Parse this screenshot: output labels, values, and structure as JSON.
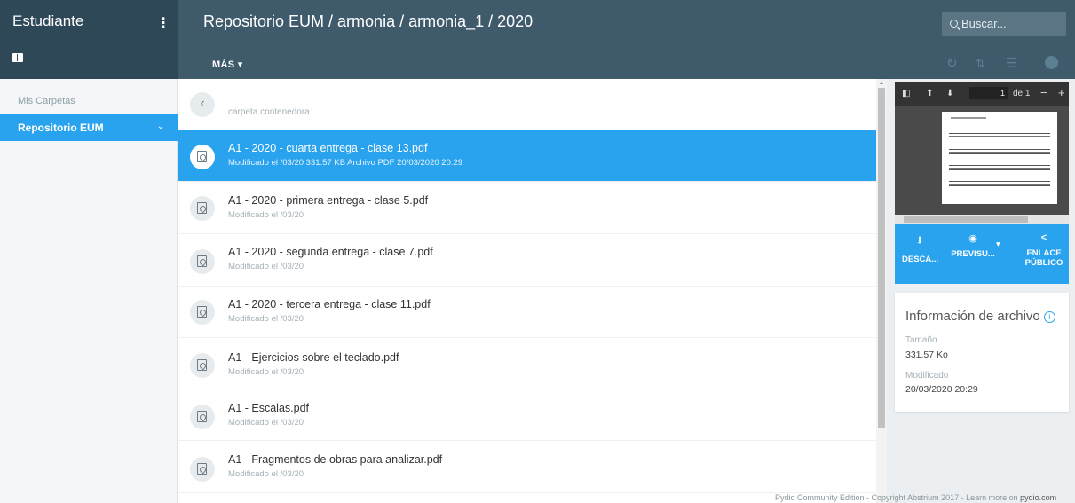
{
  "app": {
    "brand": "Estudiante"
  },
  "header": {
    "breadcrumb": "Repositorio EUM / armonia / armonia_1 / 2020",
    "search_placeholder": "Buscar...",
    "more_label": "MÁS"
  },
  "sidebar": {
    "section_label": "Mis Carpetas",
    "items": [
      {
        "label": "Repositorio EUM"
      }
    ]
  },
  "list": {
    "parent": {
      "name": "..",
      "meta": "carpeta contenedora"
    },
    "files": [
      {
        "name": "A1 - 2020 - cuarta entrega - clase 13.pdf",
        "meta": "Modificado el /03/20  331.57 KB  Archivo PDF  20/03/2020 20:29",
        "selected": true
      },
      {
        "name": "A1 - 2020 - primera entrega - clase 5.pdf",
        "meta": "Modificado el /03/20"
      },
      {
        "name": "A1 - 2020 - segunda entrega - clase 7.pdf",
        "meta": "Modificado el /03/20"
      },
      {
        "name": "A1 - 2020 - tercera entrega - clase 11.pdf",
        "meta": "Modificado el /03/20"
      },
      {
        "name": "A1 - Ejercicios sobre el teclado.pdf",
        "meta": "Modificado el /03/20"
      },
      {
        "name": "A1 - Escalas.pdf",
        "meta": "Modificado el /03/20"
      },
      {
        "name": "A1 - Fragmentos de obras para analizar.pdf",
        "meta": "Modificado el /03/20"
      }
    ]
  },
  "preview": {
    "page": "1",
    "page_of": "de 1"
  },
  "actions": {
    "download": "DESCA...",
    "preview": "PREVISU...",
    "public_link_1": "ENLACE",
    "public_link_2": "PÚBLICO"
  },
  "info": {
    "title": "Información de archivo",
    "size_label": "Tamaño",
    "size_value": "331.57 Ko",
    "modified_label": "Modificado",
    "modified_value": "20/03/2020 20:29"
  },
  "footer": {
    "text": "Pydio Community Edition - Copyright Abstrium 2017 - Learn more on",
    "link": "pydio.com"
  },
  "colors": {
    "accent": "#2aa3ef",
    "header": "#3f5a6b",
    "header_dark": "#2f4858"
  }
}
